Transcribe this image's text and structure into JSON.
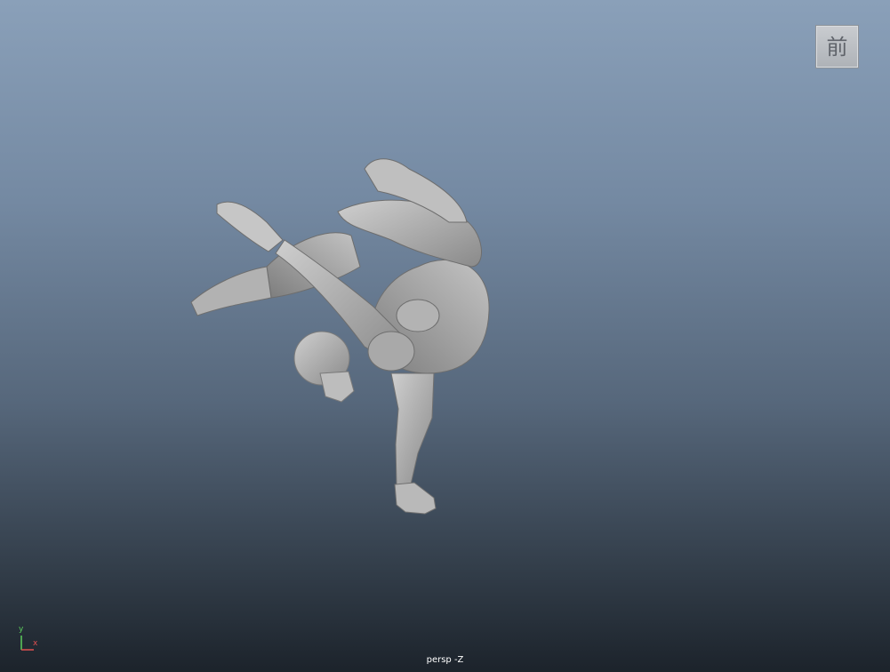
{
  "viewport": {
    "camera_label": "persp -Z",
    "viewcube_face": "前",
    "axis_indicator": {
      "y_label": "y",
      "x_label": "x"
    },
    "model": "mannequin-handstand-pose"
  },
  "colors": {
    "bg_top": "#8aa0b9",
    "bg_bottom": "#1c232b",
    "model_gray": "#a6a6a6",
    "axis_x": "#e05050",
    "axis_y": "#5ccd5c"
  }
}
